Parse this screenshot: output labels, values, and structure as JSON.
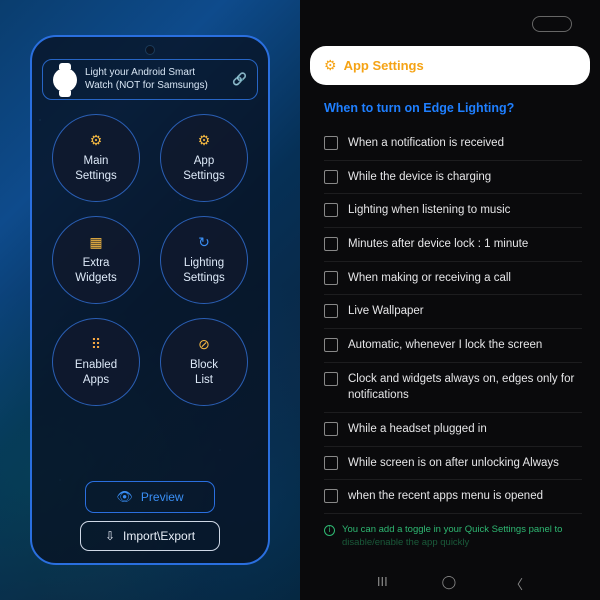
{
  "left": {
    "banner": "Light your Android Smart Watch (NOT for Samsungs)",
    "circles": [
      {
        "icon": "⚙",
        "cls": "yellow",
        "l1": "Main",
        "l2": "Settings"
      },
      {
        "icon": "⚙",
        "cls": "yellow",
        "l1": "App",
        "l2": "Settings"
      },
      {
        "icon": "▦",
        "cls": "yellow",
        "l1": "Extra",
        "l2": "Widgets"
      },
      {
        "icon": "↻",
        "cls": "blue",
        "l1": "Lighting",
        "l2": "Settings"
      },
      {
        "icon": "⠿",
        "cls": "orange",
        "l1": "Enabled",
        "l2": "Apps"
      },
      {
        "icon": "⊘",
        "cls": "yellow",
        "l1": "Block",
        "l2": "List"
      }
    ],
    "preview": "Preview",
    "impexp": "Import\\Export"
  },
  "right": {
    "header": "App Settings",
    "section": "When to turn on Edge Lighting?",
    "options": [
      "When a notification is received",
      "While the device is charging",
      "Lighting when listening to music",
      "Minutes after device lock : 1 minute",
      "When making or receiving a call",
      "Live Wallpaper",
      "Automatic, whenever I lock the screen",
      "Clock and widgets always on, edges only for notifications",
      "While a headset plugged in",
      "While screen is on after unlocking Always",
      "when the recent apps menu is opened"
    ],
    "tip1": "You can add a toggle in your Quick Settings panel to",
    "tip2": "disable/enable the app quickly"
  }
}
